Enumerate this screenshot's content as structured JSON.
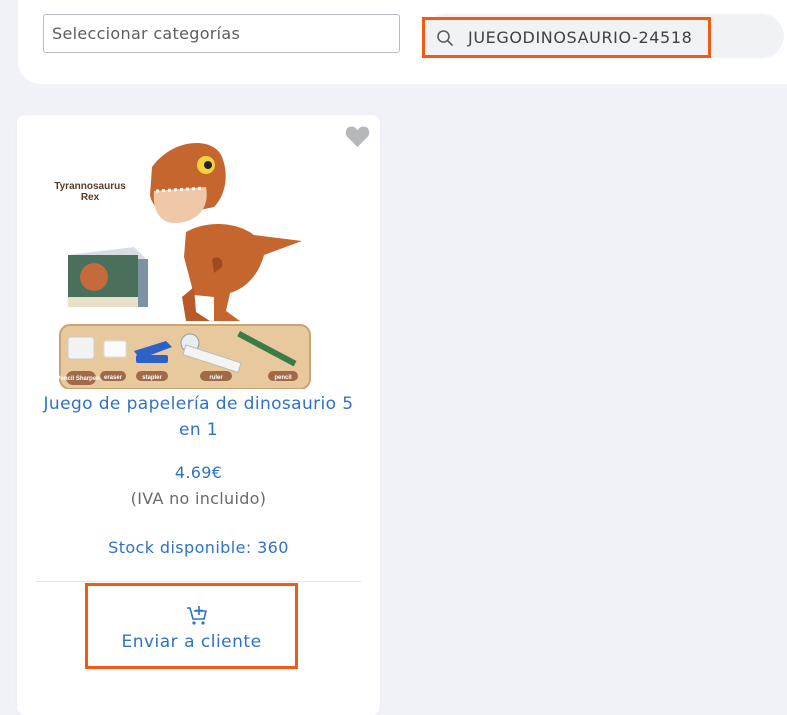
{
  "filters": {
    "category_placeholder": "Seleccionar categorías",
    "search_value": "JUEGODINOSAURIO-24518"
  },
  "product": {
    "image_labels": {
      "title": "Tyrannosaurus Rex",
      "sharpener": "Pencil Sharpener",
      "eraser": "eraser",
      "stapler": "stapler",
      "ruler": "ruler",
      "pencil": "pencil"
    },
    "title": "Juego de papelería de dinosaurio 5 en 1",
    "price": "4.69€",
    "tax_note": "(IVA no incluido)",
    "stock": "Stock disponible: 360",
    "action_label": "Enviar a cliente"
  },
  "colors": {
    "accent_blue": "#2e72c7",
    "highlight_orange": "#f05a14",
    "page_bg": "#f0f2f7"
  },
  "icons": {
    "search": "search-icon",
    "favorite": "heart-icon",
    "cart": "cart-plus-icon"
  }
}
